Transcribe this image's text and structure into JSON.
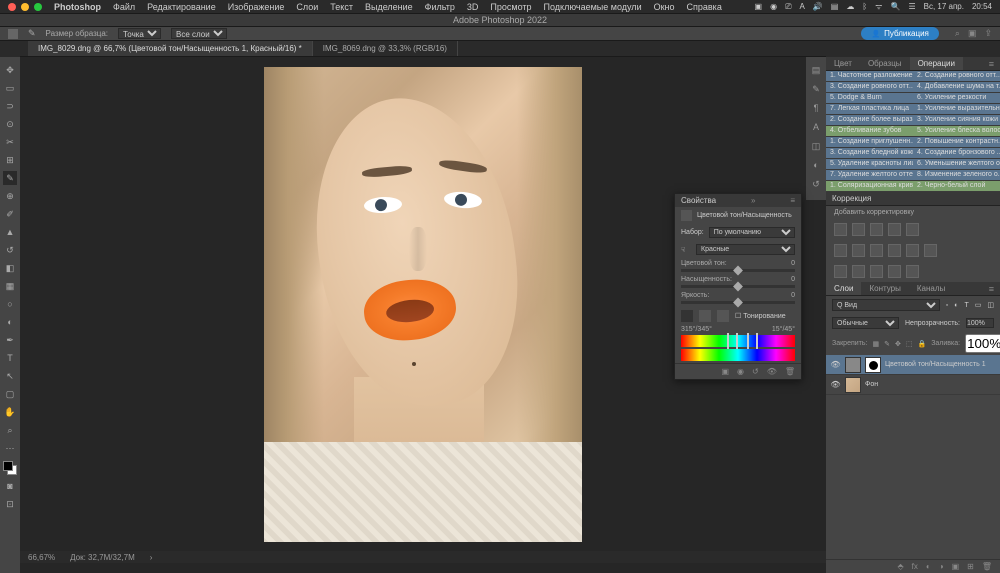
{
  "menubar": {
    "app": "Photoshop",
    "items": [
      "Файл",
      "Редактирование",
      "Изображение",
      "Слои",
      "Текст",
      "Выделение",
      "Фильтр",
      "3D",
      "Просмотр",
      "Подключаемые модули",
      "Окно",
      "Справка"
    ],
    "date": "Вс, 17 апр.",
    "time": "20:54"
  },
  "titlebar": "Adobe Photoshop 2022",
  "optbar": {
    "sample_label": "Размер образца:",
    "sample_value": "Точка",
    "layers_value": "Все слои",
    "publish": "Публикация"
  },
  "tabs": [
    {
      "label": "IMG_8029.dng @ 66,7% (Цветовой тон/Насыщенность 1, Красный/16) *",
      "active": true
    },
    {
      "label": "IMG_8069.dng @ 33,3% (RGB/16)",
      "active": false
    }
  ],
  "status": {
    "zoom": "66,67%",
    "doc": "Док: 32,7M/32,7M"
  },
  "props": {
    "title": "Свойства",
    "type": "Цветовой тон/Насыщенность",
    "preset_label": "Набор:",
    "preset": "По умолчанию",
    "channel": "Красные",
    "hue_label": "Цветовой тон:",
    "hue": "0",
    "sat_label": "Насыщенность:",
    "sat": "0",
    "lig_label": "Яркость:",
    "lig": "0",
    "colorize": "Тонирование",
    "range_left": "315°/345°",
    "range_right": "15°/45°"
  },
  "color_tabs": [
    "Цвет",
    "Образцы",
    "Операции"
  ],
  "actions": [
    [
      "1. Частотное разложение",
      "2. Создание ровного отт..."
    ],
    [
      "3. Создание ровного отт...",
      "4. Добавление шума на т..."
    ],
    [
      "5. Dodge & Burn",
      "6. Усиление резкости"
    ],
    [
      "7. Легкая пластика лица",
      "1. Усиление выразительн..."
    ],
    [
      "2. Создание более выраз...",
      "3. Усиление сияния кожи"
    ],
    [
      "4. Отбеливание зубов",
      "5. Усиление блеска волос"
    ],
    [
      "1. Создание приглушенн...",
      "2. Повышение контрастн..."
    ],
    [
      "3. Создание бледной кожи",
      "4. Создание бронзового ..."
    ],
    [
      "5. Удаление красноты лиц",
      "6. Уменьшение желтого о..."
    ],
    [
      "7. Удаление желтого отте...",
      "8. Изменение зеленого о..."
    ],
    [
      "1. Соляризационная крив...",
      "2. Черно-белый слой"
    ]
  ],
  "action_sel_rows": [
    5,
    10
  ],
  "corr_title": "Коррекция",
  "corr_sub": "Добавить корректировку",
  "layers_tabs": [
    "Слои",
    "Контуры",
    "Каналы"
  ],
  "layer_blend": "Обычные",
  "layer_opac_label": "Непрозрачность:",
  "layer_opac": "100%",
  "layer_fill_label": "Заливка:",
  "layer_fill": "100%",
  "layer_lock": "Закрепить:",
  "layer_search": "Q Вид",
  "layers": [
    {
      "name": "Цветовой тон/Насыщенность 1",
      "sel": true,
      "adj": true
    },
    {
      "name": "Фон",
      "sel": false,
      "adj": false
    }
  ]
}
